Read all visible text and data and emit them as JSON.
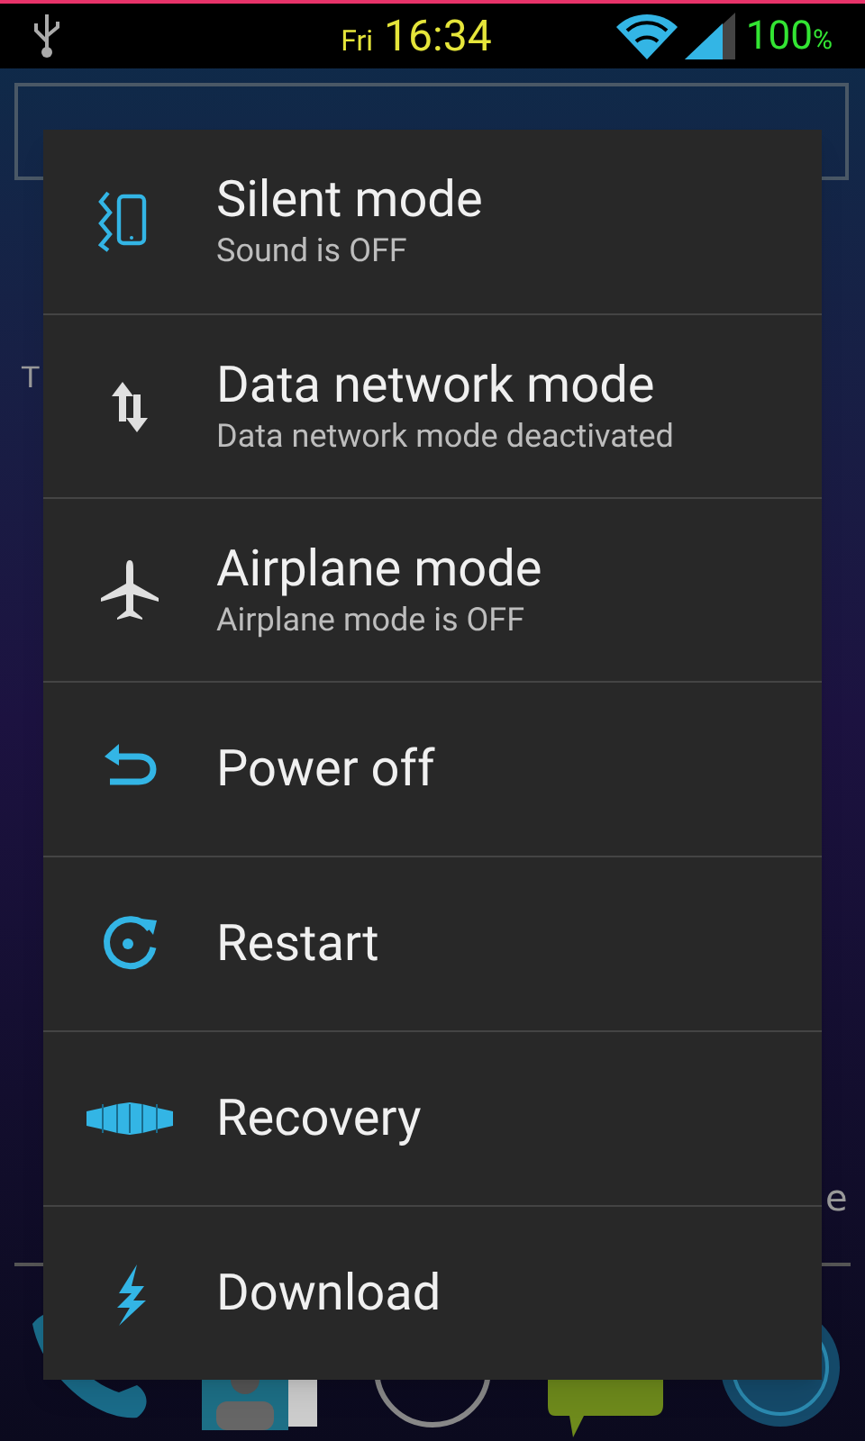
{
  "status_bar": {
    "day": "Fri",
    "time": "16:34",
    "battery": "100",
    "battery_unit": "%"
  },
  "home": {
    "left_label": "T",
    "right_label": "e"
  },
  "menu": [
    {
      "kind": "silent",
      "title": "Silent mode",
      "subtitle": "Sound is OFF"
    },
    {
      "kind": "data",
      "title": "Data network mode",
      "subtitle": "Data network mode deactivated"
    },
    {
      "kind": "airplane",
      "title": "Airplane mode",
      "subtitle": "Airplane mode is OFF"
    },
    {
      "kind": "power",
      "title": "Power off"
    },
    {
      "kind": "restart",
      "title": "Restart"
    },
    {
      "kind": "recovery",
      "title": "Recovery"
    },
    {
      "kind": "download",
      "title": "Download"
    }
  ]
}
